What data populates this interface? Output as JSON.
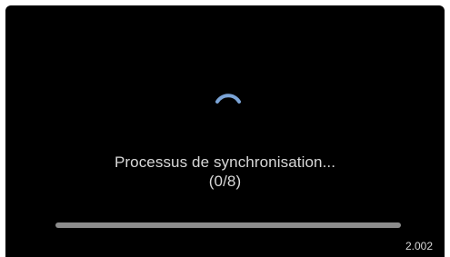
{
  "sync": {
    "status_line1": "Processus de synchronisation...",
    "status_line2": "(0/8)",
    "progress_fraction": 0
  },
  "footer": {
    "version": "2.002"
  },
  "colors": {
    "background": "#000000",
    "spinner": "#7ba4d6",
    "text": "#d8d8d8",
    "progress_track": "#8c8c8c"
  },
  "icons": {
    "spinner": "loading-spinner-icon"
  }
}
